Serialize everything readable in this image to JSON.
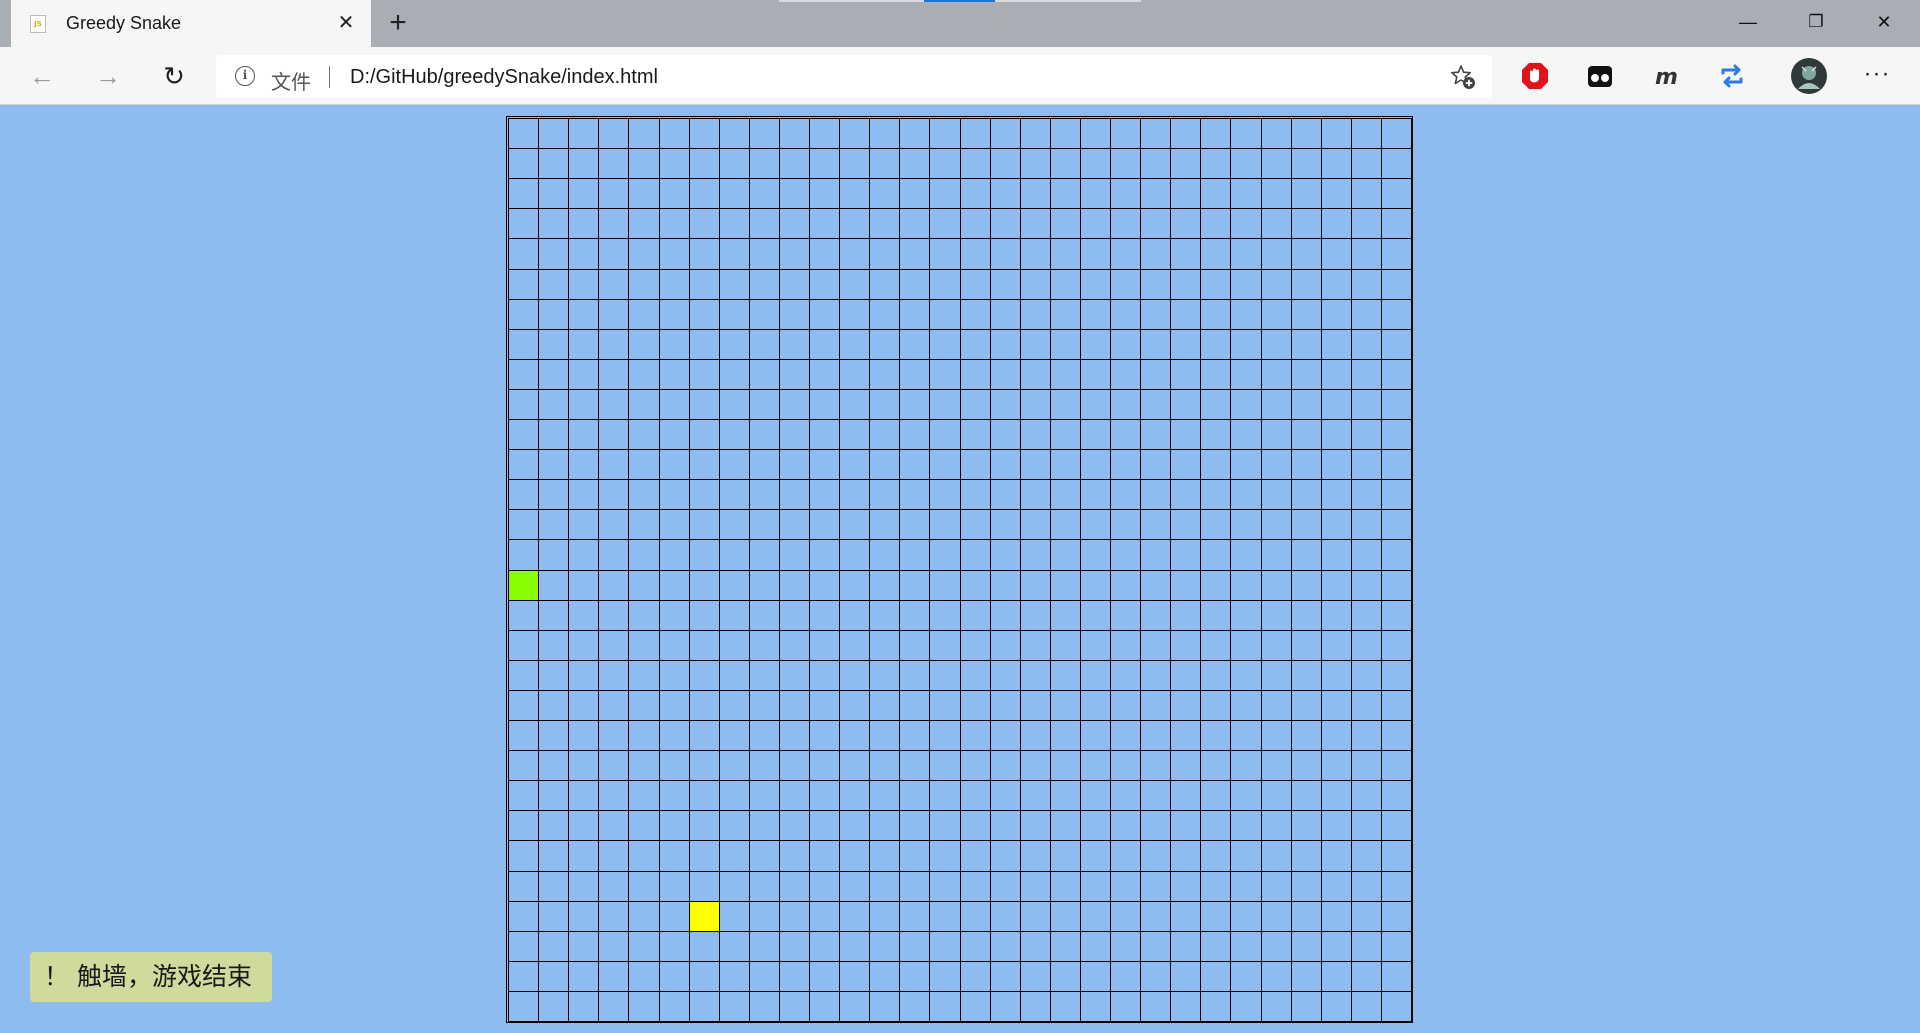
{
  "tab": {
    "title": "Greedy Snake",
    "favicon_text": "JS",
    "close_glyph": "✕"
  },
  "new_tab_glyph": "+",
  "window_controls": {
    "minimize": "—",
    "restore": "❐",
    "close": "✕"
  },
  "toolbar": {
    "back_glyph": "←",
    "forward_glyph": "→",
    "refresh_glyph": "↻",
    "info_glyph": "i",
    "file_label": "文件",
    "url": "D:/GitHub/greedySnake/index.html",
    "more_glyph": "···",
    "extensions": [
      "stop-extension-icon",
      "glasses-extension-icon",
      "m-extension-icon",
      "sync-extension-icon",
      "profile-avatar"
    ]
  },
  "game": {
    "grid_size": 30,
    "background": "#8FBCEF",
    "snake_color": "#88FF00",
    "food_color": "#FFFF00",
    "snake": [
      {
        "col": 0,
        "row": 15
      }
    ],
    "food": {
      "col": 6,
      "row": 26
    }
  },
  "toast": {
    "icon": "！",
    "message": "触墙，游戏结束"
  }
}
